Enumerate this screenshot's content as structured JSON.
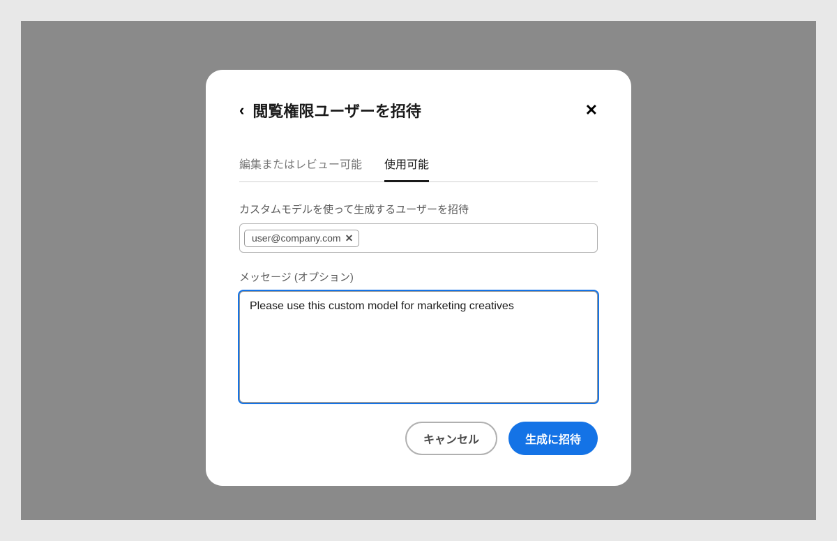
{
  "dialog": {
    "title": "閲覧権限ユーザーを招待"
  },
  "tabs": {
    "edit_review": "編集またはレビュー可能",
    "usable": "使用可能"
  },
  "invite_field": {
    "label": "カスタムモデルを使って生成するユーザーを招待",
    "chip_value": "user@company.com"
  },
  "message_field": {
    "label": "メッセージ (オプション)",
    "value": "Please use this custom model for marketing creatives"
  },
  "footer": {
    "cancel_label": "キャンセル",
    "invite_label": "生成に招待"
  }
}
